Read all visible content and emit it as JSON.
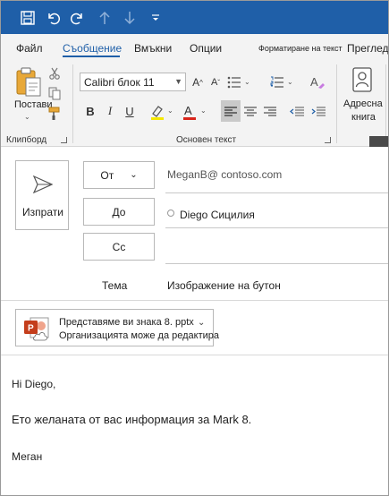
{
  "titlebar": {
    "icons": [
      "save-icon",
      "undo-icon",
      "redo-icon",
      "up-arrow-icon",
      "down-arrow-icon",
      "customize-toolbar-icon"
    ],
    "bg_color": "#1f5fa8"
  },
  "tabs": [
    {
      "label": "Файл"
    },
    {
      "label": "Съобщение",
      "active": true
    },
    {
      "label": "Вмъкни"
    },
    {
      "label": "Опции"
    },
    {
      "label": "Форматиране на текст"
    },
    {
      "label": "Преглед"
    }
  ],
  "ribbon": {
    "clipboard": {
      "paste_label": "Постави",
      "group_label": "Клипборд"
    },
    "basic_text": {
      "font_name": "Calibri блок 11",
      "bold_label": "B",
      "italic_label": "I",
      "underline_label": "U",
      "group_label": "Основен текст",
      "highlight_color": "#f5e800",
      "font_color": "#d9261c"
    },
    "names": {
      "address_book_label_line1": "Адресна",
      "address_book_label_line2": "книга"
    }
  },
  "compose": {
    "send_label": "Изпрати",
    "from_label": "От",
    "from_value": "MeganB@ contoso.com",
    "to_label": "До",
    "to_value": "Diego Сицилия",
    "cc_label": "Cc",
    "subject_label": "Тема",
    "subject_value": "Изображение на бутон"
  },
  "attachment": {
    "name": "Представяме ви знака 8. pptx",
    "subtitle": "Организацията може да редактира",
    "icon_color": "#c43e1c"
  },
  "body": {
    "greeting": "Hi Diego,",
    "message": "Ето желаната от вас информация за Mark 8.",
    "signature": "Меган"
  }
}
